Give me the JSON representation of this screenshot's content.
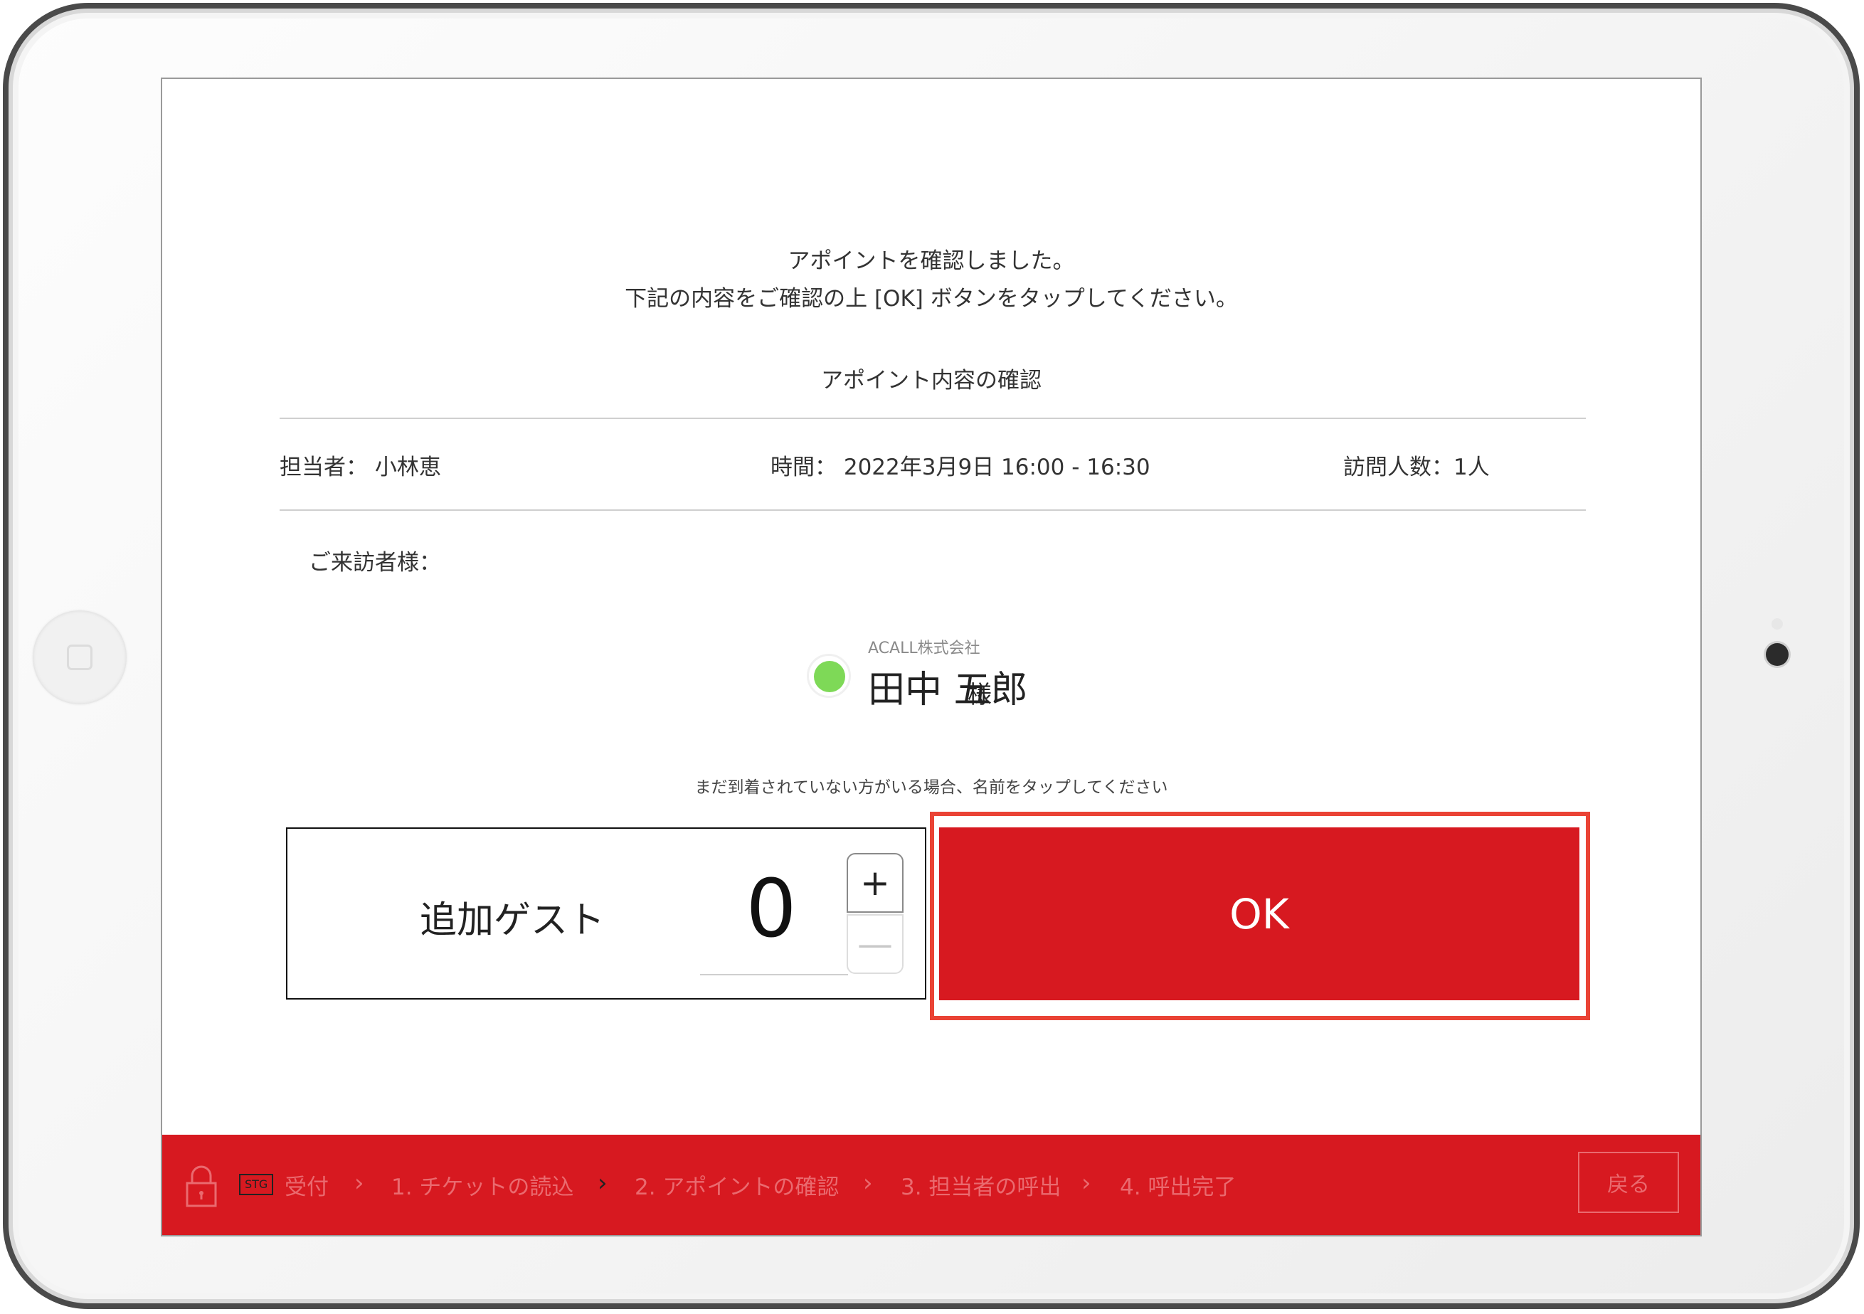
{
  "message": {
    "line1": "アポイントを確認しました。",
    "line2": "下記の内容をご確認の上 [OK] ボタンをタップしてください。"
  },
  "section_title": "アポイント内容の確認",
  "info": {
    "staff": "担当者： 小林恵",
    "time": "時間： 2022年3月9日 16:00 - 16:30",
    "visitor_count": "訪問人数：1人"
  },
  "visitor_label": "ご来訪者様：",
  "guest": {
    "company": "ACALL株式会社",
    "name": "田中 五郎",
    "honorific": "様",
    "status_color": "#7ed957"
  },
  "hint": "まだ到着されていない方がいる場合、名前をタップしてください",
  "add_guest": {
    "label": "追加ゲスト",
    "count": "0",
    "plus": "+",
    "minus": "—"
  },
  "ok_button": {
    "label": "OK",
    "color": "#d71920"
  },
  "footer": {
    "stg_badge": "STG",
    "reception": "受付",
    "steps": [
      {
        "label": "1. チケットの読込"
      },
      {
        "label": "2. アポイントの確認"
      },
      {
        "label": "3. 担当者の呼出"
      },
      {
        "label": "4. 呼出完了"
      }
    ],
    "back_label": "戻る",
    "lock_icon": "lock-icon",
    "chevron_icon": "chevron-right-icon"
  }
}
